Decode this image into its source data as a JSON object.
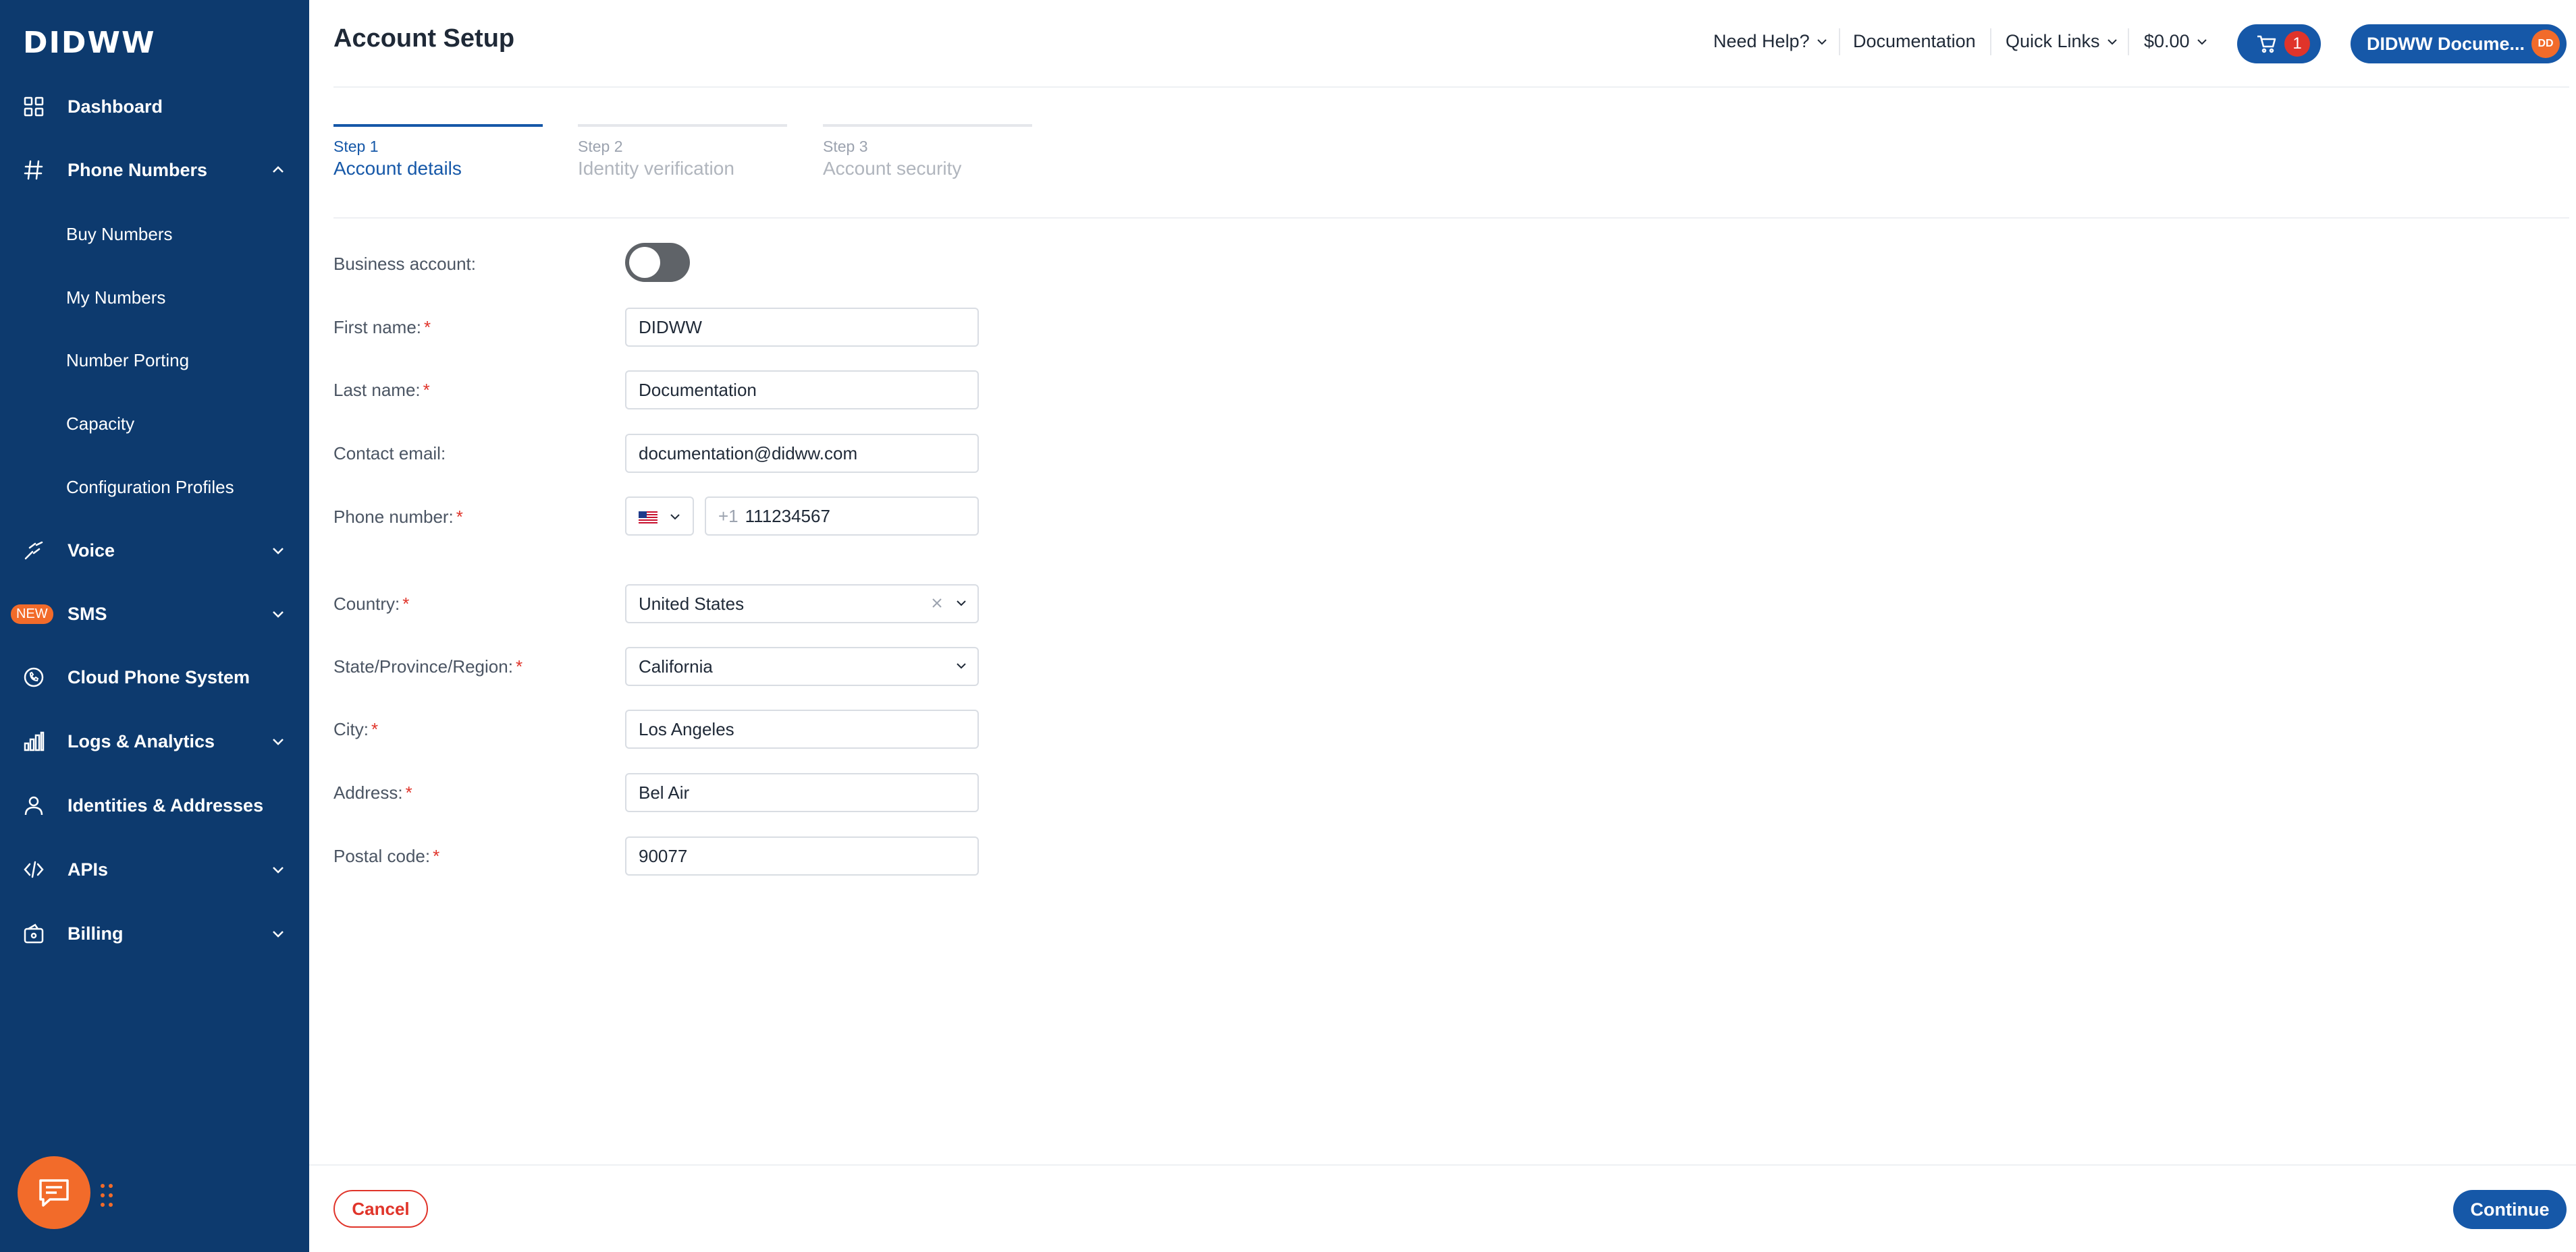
{
  "sidebar": {
    "logo": "DIDWW",
    "items": [
      {
        "label": "Dashboard",
        "icon": "grid-icon"
      },
      {
        "label": "Phone Numbers",
        "icon": "hash-icon",
        "expanded": true
      },
      {
        "label": "Buy Numbers"
      },
      {
        "label": "My Numbers"
      },
      {
        "label": "Number Porting"
      },
      {
        "label": "Capacity"
      },
      {
        "label": "Configuration Profiles"
      },
      {
        "label": "Voice",
        "icon": "voice-icon"
      },
      {
        "label": "SMS",
        "icon": "sms-icon",
        "badge": "NEW"
      },
      {
        "label": "Cloud Phone System",
        "icon": "phone-circle-icon"
      },
      {
        "label": "Logs & Analytics",
        "icon": "bar-chart-icon"
      },
      {
        "label": "Identities & Addresses",
        "icon": "user-icon"
      },
      {
        "label": "APIs",
        "icon": "code-icon"
      },
      {
        "label": "Billing",
        "icon": "wallet-icon"
      }
    ]
  },
  "header": {
    "title": "Account Setup",
    "need_help": "Need Help?",
    "documentation": "Documentation",
    "quick_links": "Quick Links",
    "balance": "$0.00",
    "cart_count": "1",
    "user_name": "DIDWW Docume...",
    "user_initials": "DD"
  },
  "steps": [
    {
      "num": "Step 1",
      "title": "Account details",
      "active": true
    },
    {
      "num": "Step 2",
      "title": "Identity verification",
      "active": false
    },
    {
      "num": "Step 3",
      "title": "Account security",
      "active": false
    }
  ],
  "form": {
    "business_account_label": "Business account:",
    "business_account_on": false,
    "first_name_label": "First name:",
    "first_name": "DIDWW",
    "last_name_label": "Last name:",
    "last_name": "Documentation",
    "email_label": "Contact email:",
    "email": "documentation@didww.com",
    "phone_label": "Phone number:",
    "phone_prefix": "+1",
    "phone": "111234567",
    "country_label": "Country:",
    "country": "United States",
    "state_label": "State/Province/Region:",
    "state": "California",
    "city_label": "City:",
    "city": "Los Angeles",
    "address_label": "Address:",
    "address": "Bel Air",
    "postal_label": "Postal code:",
    "postal": "90077",
    "required_mark": "*"
  },
  "footer": {
    "cancel": "Cancel",
    "continue": "Continue"
  },
  "colors": {
    "sidebar": "#0d3a6e",
    "primary": "#1658a8",
    "accent": "#f26b2a",
    "required": "#e0342a"
  }
}
